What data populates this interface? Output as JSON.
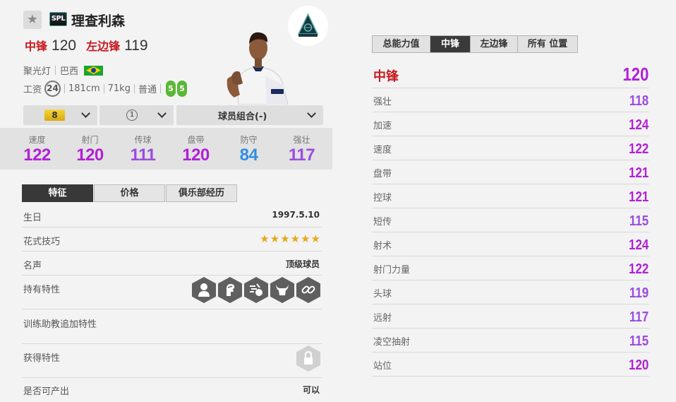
{
  "header": {
    "season_badge": "SPL",
    "player_name": "理查利森",
    "positions": [
      {
        "pos": "中锋",
        "ovr": "120"
      },
      {
        "pos": "左边锋",
        "ovr": "119"
      }
    ],
    "meta": {
      "role": "聚光灯",
      "nationality": "巴西"
    },
    "stats_line": {
      "wage_label": "工资",
      "wage": "24",
      "height": "181cm",
      "weight": "71kg",
      "skill": "普通",
      "foot_left": "5",
      "foot_right": "5"
    }
  },
  "selectors": {
    "level": "8",
    "grade": "1",
    "combo": "球员组合(-)"
  },
  "summary_stats": [
    {
      "label": "速度",
      "value": "122",
      "color": "#b21fd6"
    },
    {
      "label": "射门",
      "value": "120",
      "color": "#b21fd6"
    },
    {
      "label": "传球",
      "value": "111",
      "color": "#9b4be0"
    },
    {
      "label": "盘带",
      "value": "120",
      "color": "#b21fd6"
    },
    {
      "label": "防守",
      "value": "84",
      "color": "#2f8fe0"
    },
    {
      "label": "强壮",
      "value": "117",
      "color": "#9b4be0"
    }
  ],
  "left_tabs": [
    "特征",
    "价格",
    "俱乐部经历"
  ],
  "info": {
    "birthday_label": "生日",
    "birthday": "1997.5.10",
    "skill_moves_label": "花式技巧",
    "skill_stars": [
      "★",
      "★",
      "★",
      "★",
      "★",
      "★"
    ],
    "reputation_label": "名声",
    "reputation": "顶级球员",
    "traits_label": "持有特性",
    "trainer_label": "训练助教追加特性",
    "obtained_label": "获得特性",
    "tradable_label": "是否可产出",
    "tradable": "可以"
  },
  "right_tabs": [
    "总能力值",
    "中锋",
    "左边锋",
    "所有 位置"
  ],
  "position_detail": {
    "title": "中锋",
    "title_value": "120",
    "rows": [
      {
        "label": "强壮",
        "value": "118",
        "color": "#9b4be0"
      },
      {
        "label": "加速",
        "value": "124",
        "color": "#b21fd6"
      },
      {
        "label": "速度",
        "value": "122",
        "color": "#b21fd6"
      },
      {
        "label": "盘带",
        "value": "121",
        "color": "#b21fd6"
      },
      {
        "label": "控球",
        "value": "121",
        "color": "#b21fd6"
      },
      {
        "label": "短传",
        "value": "115",
        "color": "#9b4be0"
      },
      {
        "label": "射术",
        "value": "124",
        "color": "#b21fd6"
      },
      {
        "label": "射门力量",
        "value": "122",
        "color": "#b21fd6"
      },
      {
        "label": "头球",
        "value": "119",
        "color": "#9b4be0"
      },
      {
        "label": "远射",
        "value": "117",
        "color": "#9b4be0"
      },
      {
        "label": "凌空抽射",
        "value": "115",
        "color": "#9b4be0"
      },
      {
        "label": "站位",
        "value": "120",
        "color": "#b21fd6"
      }
    ]
  }
}
